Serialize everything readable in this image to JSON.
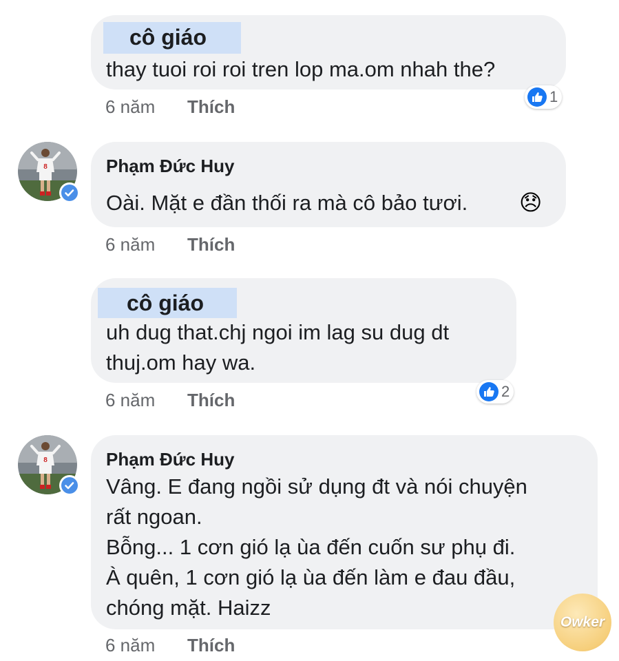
{
  "comments": [
    {
      "author": "cô giáo",
      "lines": [
        "thay tuoi roi roi tren lop ma.om nhah the?"
      ],
      "time": "6 năm",
      "like_label": "Thích",
      "reaction_count": "1"
    },
    {
      "author": "Phạm Đức Huy",
      "avatar_number": "8",
      "lines": [
        "Oài. Mặt e đần thối ra mà cô bảo tươi."
      ],
      "emoji": "😞",
      "time": "6 năm",
      "like_label": "Thích"
    },
    {
      "author": "cô giáo",
      "lines": [
        "uh dug that.chj ngoi im lag su dug dt",
        "thuj.om hay wa."
      ],
      "time": "6 năm",
      "like_label": "Thích",
      "reaction_count": "2"
    },
    {
      "author": "Phạm Đức Huy",
      "avatar_number": "8",
      "lines": [
        "Vâng. E đang ngồi sử dụng đt và nói chuyện",
        "rất ngoan.",
        "Bỗng... 1 cơn gió lạ ùa đến cuốn sư phụ đi.",
        "À quên, 1 cơn gió lạ ùa đến làm e đau đầu,",
        "chóng mặt. Haizz"
      ],
      "time": "6 năm",
      "like_label": "Thích"
    }
  ],
  "watermark": "Owker",
  "colors": {
    "bubble": "#f0f1f3",
    "name_highlight": "#cfe0f7",
    "like_blue": "#1877f2",
    "meta_gray": "#65676b",
    "verified_blue": "#4a8fe8"
  },
  "icons": {
    "reaction": "thumbs-up-icon",
    "verified": "verified-badge-icon",
    "emoji": "disappointed-face-emoji"
  }
}
